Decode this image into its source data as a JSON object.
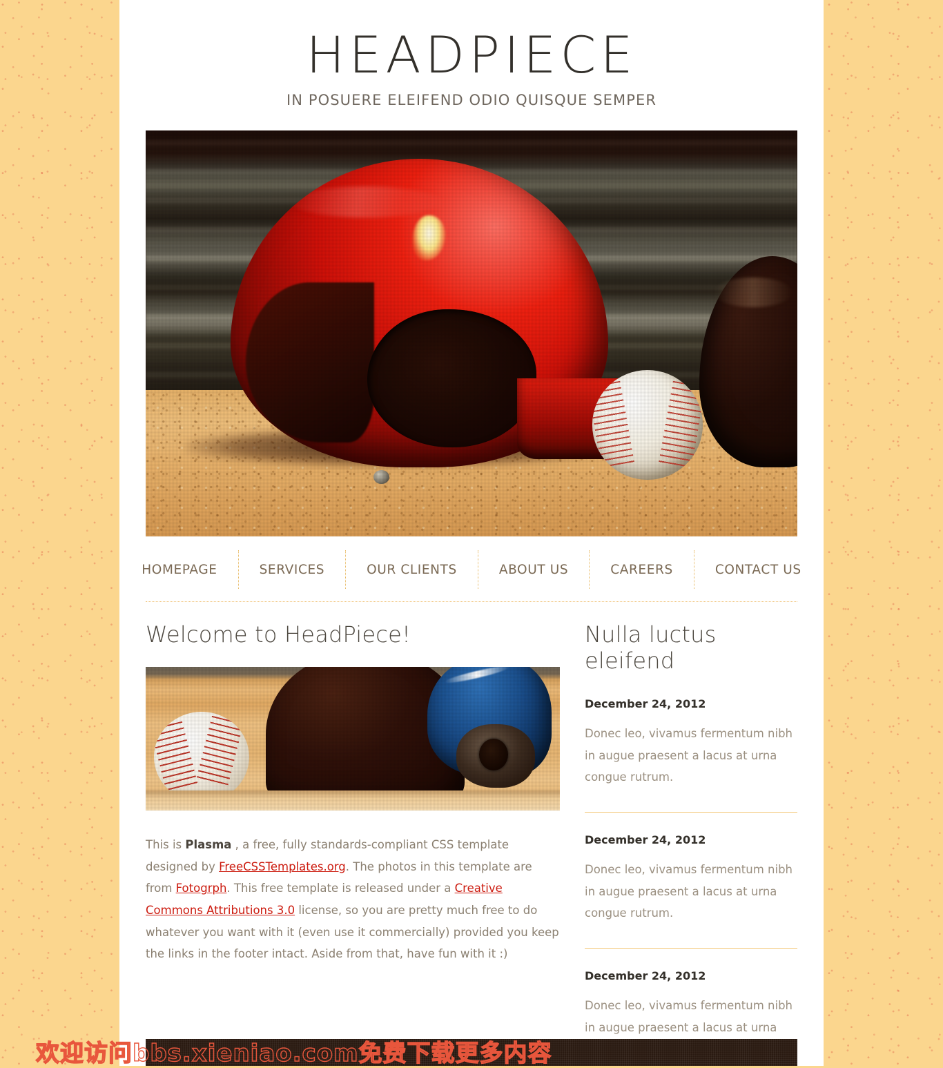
{
  "header": {
    "title": "HEADPIECE",
    "tagline": "IN POSUERE ELEIFEND ODIO QUISQUE SEMPER"
  },
  "nav": {
    "items": [
      {
        "label": "HOMEPAGE"
      },
      {
        "label": "SERVICES"
      },
      {
        "label": "OUR CLIENTS"
      },
      {
        "label": "ABOUT US"
      },
      {
        "label": "CAREERS"
      },
      {
        "label": "CONTACT US"
      }
    ]
  },
  "hero": {
    "alt": "red baseball batting helmet and baseball on sand"
  },
  "main": {
    "heading": "Welcome to HeadPiece!",
    "post_image_alt": "dark and blue baseball helmets with baseball on sand",
    "body": {
      "t1": "This is ",
      "strong1": "Plasma",
      "t2": " , a free, fully standards-compliant CSS template designed by ",
      "link1": "FreeCSSTemplates.org",
      "t3": ". The photos in this template are from ",
      "link2": "Fotogrph",
      "t4": ". This free template is released under a ",
      "link3": "Creative Commons Attributions 3.0",
      "t5": " license, so you are pretty much free to do whatever you want with it (even use it commercially) provided you keep the links in the footer intact. Aside from that, have fun with it :)"
    }
  },
  "sidebar": {
    "heading": "Nulla luctus eleifend",
    "entries": [
      {
        "date": "December 24, 2012",
        "text": "Donec leo, vivamus fermentum nibh in augue praesent a lacus at urna congue rutrum."
      },
      {
        "date": "December 24, 2012",
        "text": "Donec leo, vivamus fermentum nibh in augue praesent a lacus at urna congue rutrum."
      },
      {
        "date": "December 24, 2012",
        "text": "Donec leo, vivamus fermentum nibh in augue praesent a lacus at urna congue rutrum."
      }
    ]
  },
  "footer": {
    "watermark": "欢迎访问bbs.xieniao.com免费下载更多内容"
  },
  "colors": {
    "page_background": "#fbd68e",
    "container": "#ffffff",
    "title": "#33302b",
    "tagline": "#6f675e",
    "nav_text": "#7b6a55",
    "rule": "#efc072",
    "link": "#cc1b0f",
    "body_text": "#8b8071",
    "footer_bar": "#2a1a11",
    "watermark": "#e8563c"
  }
}
